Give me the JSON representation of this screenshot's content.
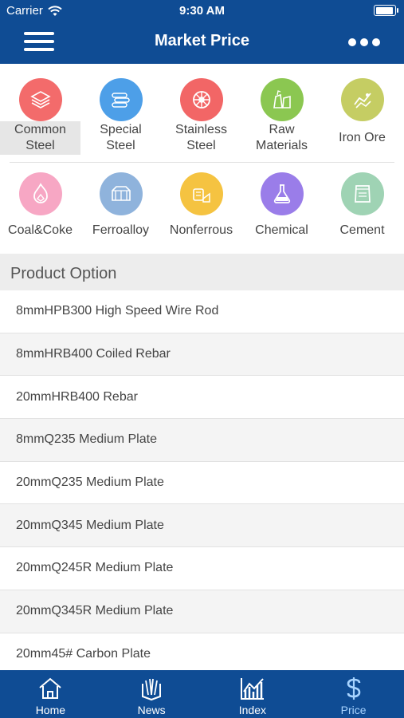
{
  "status_bar": {
    "carrier": "Carrier",
    "time": "9:30 AM",
    "battery_level": 0.95
  },
  "nav": {
    "title": "Market Price",
    "menu_icon": "hamburger-icon",
    "more_icon": "more-icon"
  },
  "categories": {
    "row1": [
      {
        "label": "Common\nSteel",
        "color": "#f36b6b",
        "icon": "steel-sheets-icon",
        "selected": true
      },
      {
        "label": "Special\nSteel",
        "color": "#4d9fe8",
        "icon": "steel-bars-icon",
        "selected": false
      },
      {
        "label": "Stainless\nSteel",
        "color": "#f26666",
        "icon": "wheel-icon",
        "selected": false
      },
      {
        "label": "Raw\nMaterials",
        "color": "#8bc751",
        "icon": "materials-icon",
        "selected": false
      },
      {
        "label": "Iron Ore",
        "color": "#c5cd63",
        "icon": "ore-icon",
        "selected": false
      }
    ],
    "row2": [
      {
        "label": "Coal&Coke",
        "color": "#f7a7c4",
        "icon": "coal-icon",
        "selected": false
      },
      {
        "label": "Ferroalloy",
        "color": "#8fb3dc",
        "icon": "ferroalloy-icon",
        "selected": false
      },
      {
        "label": "Nonferrous",
        "color": "#f5c341",
        "icon": "nonferrous-icon",
        "selected": false
      },
      {
        "label": "Chemical",
        "color": "#9a7de9",
        "icon": "flask-icon",
        "selected": false
      },
      {
        "label": "Cement",
        "color": "#9fd3b4",
        "icon": "cement-bag-icon",
        "selected": false
      }
    ]
  },
  "section": {
    "title": "Product Option"
  },
  "products": [
    "8mmHPB300 High Speed Wire Rod",
    "8mmHRB400 Coiled Rebar",
    "20mmHRB400 Rebar",
    "8mmQ235 Medium Plate",
    "20mmQ235 Medium Plate",
    "20mmQ345 Medium Plate",
    "20mmQ245R Medium Plate",
    "20mmQ345R Medium Plate",
    "20mm45# Carbon Plate"
  ],
  "tabs": [
    {
      "label": "Home",
      "icon": "home-icon",
      "active": false
    },
    {
      "label": "News",
      "icon": "news-icon",
      "active": false
    },
    {
      "label": "Index",
      "icon": "chart-icon",
      "active": false
    },
    {
      "label": "Price",
      "icon": "dollar-icon",
      "active": true
    }
  ],
  "colors": {
    "brand": "#0f4c94",
    "active_tab": "#a8d4ff",
    "selected_bg": "#e6e6e6"
  }
}
